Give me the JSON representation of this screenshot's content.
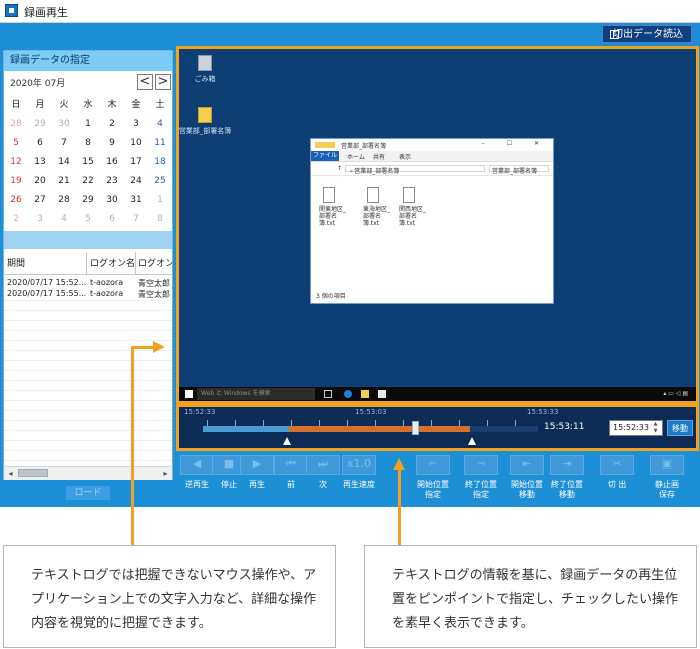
{
  "colors": {
    "accent": "#f0a11f",
    "app_bg": "#1d8fd6",
    "panel_head": "#7ccbf2"
  },
  "window": {
    "title": "録画再生"
  },
  "header": {
    "load_file_label": "切出データ読込"
  },
  "left_panel": {
    "title": "録画データの指定",
    "month": "2020年 07月",
    "prev": "<",
    "next": ">",
    "weekdays": [
      "日",
      "月",
      "火",
      "水",
      "木",
      "金",
      "土"
    ],
    "weeks": [
      [
        "28",
        "29",
        "30",
        "1",
        "2",
        "3",
        "4"
      ],
      [
        "5",
        "6",
        "7",
        "8",
        "9",
        "10",
        "11"
      ],
      [
        "12",
        "13",
        "14",
        "15",
        "16",
        "17",
        "18"
      ],
      [
        "19",
        "20",
        "21",
        "22",
        "23",
        "24",
        "25"
      ],
      [
        "26",
        "27",
        "28",
        "29",
        "30",
        "31",
        "1"
      ],
      [
        "2",
        "3",
        "4",
        "5",
        "6",
        "7",
        "8"
      ]
    ],
    "table_headers": [
      "期間",
      "ログオン名",
      "ログオン表"
    ],
    "rows": [
      [
        "2020/07/17 15:52...",
        "t-aozora",
        "青空太郎"
      ],
      [
        "2020/07/17 15:55...",
        "t-aozora",
        "青空太郎"
      ]
    ],
    "scroll_left": "◂",
    "scroll_right": "▸",
    "load_button": "ロード"
  },
  "desktop": {
    "icons": [
      {
        "label": "ごみ箱",
        "icon": "recycle-bin-icon"
      },
      {
        "label": "営業部_部署名簿",
        "icon": "folder-icon"
      }
    ],
    "explorer": {
      "title": "営業部_部署名簿",
      "window_controls": "– ☐ ✕",
      "ribbon_tabs": [
        "ファイル",
        "ホーム",
        "共有",
        "表示"
      ],
      "address_arrow": "↑",
      "address_path": "› 営業部_部署名簿",
      "search_text": "営業部_部署名簿",
      "files": [
        "関東地区_部署名簿.txt",
        "東海地区_部署名簿.txt",
        "関西地区_部署名簿.txt"
      ],
      "status": "3 個の項目"
    },
    "taskbar_search": "Web と Windows を検索"
  },
  "timeline": {
    "labels": [
      "15:52:33",
      "15:53:03",
      "15:53:33"
    ],
    "current_time": "15:53:11",
    "jump_time": "15:52:33",
    "move_button": "移動",
    "spin_up": "▲",
    "spin_down": "▼",
    "progress": 0.66
  },
  "toolbar": {
    "buttons": [
      {
        "label": "逆再生",
        "glyph": "◀"
      },
      {
        "label": "停止",
        "glyph": "■"
      },
      {
        "label": "再生",
        "glyph": "▶"
      },
      {
        "label": "前",
        "glyph": "⏮"
      },
      {
        "label": "次",
        "glyph": "⏭"
      },
      {
        "label": "再生速度",
        "glyph": "x1.0"
      },
      {
        "label": "開始位置\n指定",
        "glyph": "⌐"
      },
      {
        "label": "終了位置\n指定",
        "glyph": "¬"
      },
      {
        "label": "開始位置\n移動",
        "glyph": "⇤"
      },
      {
        "label": "終了位置\n移動",
        "glyph": "⇥"
      },
      {
        "label": "切 出",
        "glyph": "✂"
      },
      {
        "label": "静止画\n保存",
        "glyph": "▣"
      }
    ]
  },
  "notes": {
    "left": "テキストログでは把握できないマウス操作や、アプリケーション上での文字入力など、詳細な操作内容を視覚的に把握できます。",
    "right": "テキストログの情報を基に、録画データの再生位置をピンポイントで指定し、チェックしたい操作を素早く表示できます。"
  }
}
